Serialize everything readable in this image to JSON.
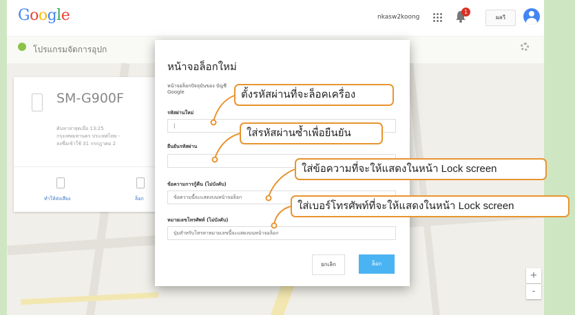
{
  "header": {
    "logo_letters": [
      {
        "char": "G",
        "color": "#4285f4"
      },
      {
        "char": "o",
        "color": "#ea4335"
      },
      {
        "char": "o",
        "color": "#fbbc05"
      },
      {
        "char": "g",
        "color": "#4285f4"
      },
      {
        "char": "l",
        "color": "#34a853"
      },
      {
        "char": "e",
        "color": "#ea4335"
      }
    ],
    "account_email": "nkasw2koong",
    "notification_count": "1",
    "language_label": "ผลวี",
    "apps_icon": "apps-grid-icon",
    "bell_icon": "bell-icon",
    "avatar_icon": "account-avatar-icon"
  },
  "subbar": {
    "title": "โปรแกรมจัดการอุปก"
  },
  "device_card": {
    "name": "SM-G900F",
    "info_lines": [
      "ค้นหาล่าสุดเมื่อ 13:25",
      "กรุงเทพมหานคร ประเทศไทย -",
      "ลงชื่อเข้าใช้ 31 กรกฎาคม 2"
    ],
    "actions": [
      "ทำให้ส่งเสียง",
      "ล็อก"
    ]
  },
  "dialog": {
    "title": "หน้าจอล็อกใหม่",
    "description": "หน้าจอล็อกปัจจุบันของ บัญชี Google",
    "fields": [
      {
        "label": "รหัสผ่านใหม่",
        "value": "|"
      },
      {
        "label": "ยืนยันรหัสผ่าน",
        "value": ""
      },
      {
        "label": "ข้อความการกู้คืน (ไม่บังคับ)",
        "value": "ข้อความนี้จะแสดงบนหน้าจอล็อก"
      },
      {
        "label": "หมายเลขโทรศัพท์ (ไม่บังคับ)",
        "value": "ปุ่มสำหรับโทรหาหมายเลขนี้จะแสดงบนหน้าจอล็อก"
      }
    ],
    "cancel_label": "ยกเลิก",
    "lock_label": "ล็อก"
  },
  "callouts": [
    "ตั้งรหัสผ่านที่จะล็อคเครื่อง",
    "ใส่รหัสผ่านซ้ำเพื่อยืนยัน",
    "ใส่ข้อความที่จะให้แสดงในหน้า Lock screen",
    "ใส่เบอร์โทรศัพท์ที่จะให้แสดงในหน้า Lock screen"
  ],
  "map_controls": [
    "+",
    "-"
  ],
  "colors": {
    "accent_orange": "#e8932e",
    "lock_button": "#4ab3f1",
    "google_blue": "#4285f4"
  }
}
